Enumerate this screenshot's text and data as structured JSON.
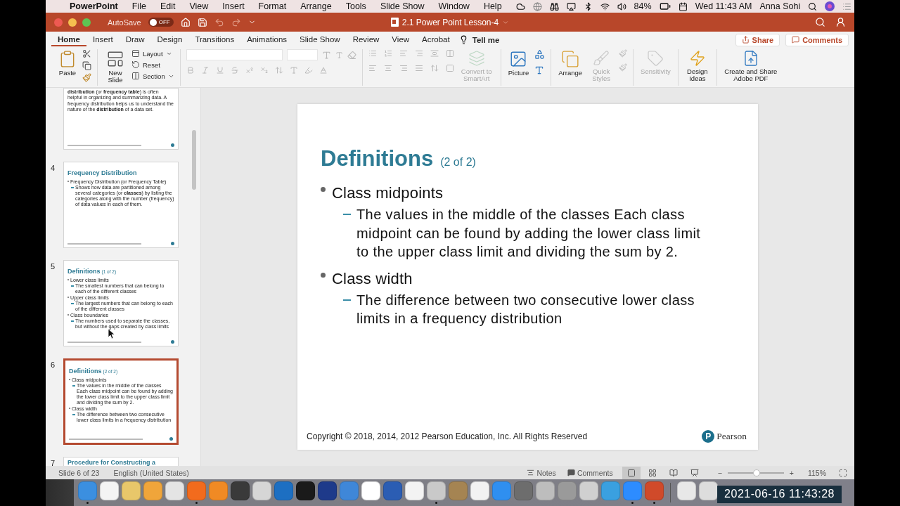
{
  "menu_bar": {
    "app_name": "PowerPoint",
    "menus": [
      "File",
      "Edit",
      "View",
      "Insert",
      "Format",
      "Arrange",
      "Tools",
      "Slide Show",
      "Window",
      "Help"
    ],
    "battery": "84%",
    "clock": "Wed 11:43 AM",
    "user": "Anna Sohi"
  },
  "title_bar": {
    "autosave": "AutoSave",
    "autosave_toggle": {
      "on": false,
      "label": "OFF"
    },
    "title": "2.1 Power Point Lesson-4"
  },
  "tabs": [
    {
      "label": "Home",
      "selected": true
    },
    {
      "label": "Insert",
      "selected": false
    },
    {
      "label": "Draw",
      "selected": false
    },
    {
      "label": "Design",
      "selected": false
    },
    {
      "label": "Transitions",
      "selected": false
    },
    {
      "label": "Animations",
      "selected": false
    },
    {
      "label": "Slide Show",
      "selected": false
    },
    {
      "label": "Review",
      "selected": false
    },
    {
      "label": "View",
      "selected": false
    },
    {
      "label": "Acrobat",
      "selected": false
    }
  ],
  "tell_me": "Tell me",
  "share": "Share",
  "comments": "Comments",
  "ribbon": {
    "paste": {
      "label": "Paste",
      "disabled": false
    },
    "new_slide": {
      "label": "New Slide",
      "disabled": false
    },
    "slide_menu": [
      {
        "label": "Layout",
        "caret": true
      },
      {
        "label": "Reset",
        "caret": false
      },
      {
        "label": "Section",
        "caret": true
      }
    ],
    "smartart": {
      "label": "Convert to SmartArt",
      "disabled": true
    },
    "picture": {
      "label": "Picture",
      "disabled": false
    },
    "arrange": {
      "label": "Arrange",
      "disabled": false
    },
    "quick_styles": {
      "label": "Quick Styles",
      "disabled": true
    },
    "sensitivity": {
      "label": "Sensitivity",
      "disabled": true
    },
    "design_ideas": {
      "label": "Design Ideas",
      "disabled": false
    },
    "adobe_pdf": {
      "label": "Create and Share Adobe PDF",
      "disabled": false
    }
  },
  "thumbnails": [
    {
      "paragraph": "**distribution** (or **frequency table**) is often helpful in organizing and summarizing data. A frequency distribution helps us to understand the nature of the **distribution** of a data set.",
      "selected": false
    },
    {
      "number": "4",
      "title": "Frequency Distribution",
      "bullets": [
        {
          "text": "Frequency Distribution (or Frequency Table)",
          "children": [
            {
              "text": "Shows how data are partitioned among several categories (or **classes**) by listing the categories along with the number (frequency) of data values in each of them."
            }
          ]
        }
      ],
      "selected": false
    },
    {
      "number": "5",
      "title": "Definitions",
      "subtitle": "(1 of 2)",
      "bullets": [
        {
          "text": "Lower class limits",
          "children": [
            {
              "text": "The smallest numbers that can belong to each of the different classes"
            }
          ]
        },
        {
          "text": "Upper class limits",
          "children": [
            {
              "text": "The largest numbers that can belong to each of the different classes"
            }
          ]
        },
        {
          "text": "Class boundaries",
          "children": [
            {
              "text": "The numbers used to separate the classes, but without the gaps created by class limits"
            }
          ]
        }
      ],
      "selected": false
    },
    {
      "number": "6",
      "title": "Definitions",
      "subtitle": "(2 of 2)",
      "bullets": [
        {
          "text": "Class midpoints",
          "children": [
            {
              "text": "The values in the middle of the classes Each class midpoint can be found by adding the lower class limit to the upper class limit and dividing the sum by 2."
            }
          ]
        },
        {
          "text": "Class width",
          "children": [
            {
              "text": "The difference between two consecutive lower class limits in a frequency distribution"
            }
          ]
        }
      ],
      "selected": true
    },
    {
      "number": "7",
      "title": "Procedure for Constructing a",
      "selected": false
    }
  ],
  "slide": {
    "title": "Definitions",
    "subtitle": "(2 of 2)",
    "bullets": [
      {
        "text": "Class midpoints",
        "children": [
          {
            "text": "The values in the middle of the classes Each class midpoint can be found by adding the lower class limit to the upper class limit and dividing the sum by 2."
          }
        ]
      },
      {
        "text": "Class width",
        "children": [
          {
            "text": "The difference between two consecutive lower class limits in a frequency distribution"
          }
        ]
      }
    ],
    "footer": "Copyright © 2018, 2014, 2012 Pearson Education, Inc. All Rights Reserved",
    "logo_mark": "P",
    "logo_name": "Pearson"
  },
  "status_bar": {
    "slide_info": "Slide 6 of 23",
    "language": "English (United States)",
    "notes": "Notes",
    "comments": "Comments",
    "views": [
      {
        "kind": "normal",
        "selected": true
      },
      {
        "kind": "sorter",
        "selected": false
      },
      {
        "kind": "reading",
        "selected": false
      },
      {
        "kind": "slideshow",
        "selected": false
      }
    ],
    "zoom": {
      "minus": "−",
      "plus": "+",
      "level": 0.52,
      "reading": "115%"
    }
  },
  "dock": [
    {
      "kind": "app",
      "running": true
    },
    {
      "kind": "app",
      "running": false
    },
    {
      "kind": "app",
      "running": false
    },
    {
      "kind": "app",
      "running": false
    },
    {
      "kind": "app",
      "running": false
    },
    {
      "kind": "app",
      "running": true
    },
    {
      "kind": "app",
      "running": false
    },
    {
      "kind": "app",
      "running": false
    },
    {
      "kind": "app",
      "running": false
    },
    {
      "kind": "app",
      "running": false
    },
    {
      "kind": "app",
      "running": false
    },
    {
      "kind": "app",
      "running": false
    },
    {
      "kind": "app",
      "running": false
    },
    {
      "kind": "app",
      "running": false
    },
    {
      "kind": "app",
      "running": false
    },
    {
      "kind": "app",
      "running": false
    },
    {
      "kind": "app",
      "running": true
    },
    {
      "kind": "app",
      "running": false
    },
    {
      "kind": "app",
      "running": false
    },
    {
      "kind": "app",
      "running": false
    },
    {
      "kind": "app",
      "running": false
    },
    {
      "kind": "app",
      "running": false
    },
    {
      "kind": "app",
      "running": false
    },
    {
      "kind": "app",
      "running": false
    },
    {
      "kind": "app",
      "running": false
    },
    {
      "kind": "app",
      "running": true
    },
    {
      "kind": "app",
      "running": true
    },
    {
      "kind": "separator"
    },
    {
      "kind": "app",
      "running": false
    },
    {
      "kind": "app",
      "running": false
    }
  ],
  "recording_timestamp": "2021-06-16 11:43:28"
}
